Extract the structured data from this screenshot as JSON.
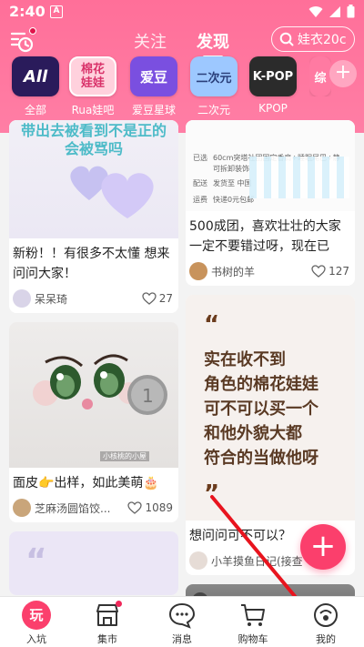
{
  "status_bar": {
    "time": "2:40",
    "notif_glyph": "A"
  },
  "nav": {
    "tabs": [
      {
        "label": "关注",
        "active": false
      },
      {
        "label": "发现",
        "active": true
      }
    ],
    "search_placeholder": "娃衣20c"
  },
  "channels": [
    {
      "icon_text": "All",
      "label": "全部",
      "color": "#2a1b5b",
      "selected": false
    },
    {
      "icon_text": "棉花\n娃娃",
      "label": "Rua娃吧",
      "color": "#ff8eb0",
      "selected": true
    },
    {
      "icon_text": "爱豆",
      "label": "爱豆星球",
      "color": "#7a4fe0",
      "selected": false
    },
    {
      "icon_text": "二次元",
      "label": "二次元",
      "color": "#9dc8ff",
      "selected": false
    },
    {
      "icon_text": "K-POP",
      "label": "KPOP",
      "color": "#2b2b2b",
      "selected": false
    },
    {
      "icon_text": "综",
      "label": "",
      "color": "#ff7aa2",
      "selected": false
    }
  ],
  "feed": {
    "left": [
      {
        "caption": "带出去被看到不是正的\n会被骂吗",
        "title": "新粉！！有很多不太懂 想来问问大家！",
        "author": "呆呆琦",
        "likes": "27"
      },
      {
        "title": "面皮👉出样，如此美萌🎂",
        "author": "芝麻汤圆馅饺...",
        "likes": "1089",
        "image_label": "小核桃的小屋"
      },
      {
        "quote_mark": "“"
      }
    ],
    "right": [
      {
        "list_rows": [
          "60cm突塔社团国定香肩+睡眠尾巴+静",
          "可拆卸装饰",
          "发货至 中国",
          "快递0元包邮"
        ],
        "list_keys": [
          "已选",
          "配送",
          "运费"
        ],
        "title": "500成团，喜欢壮壮的大家一定不要错过呀，现在已",
        "author": "书树的羊",
        "likes": "127"
      },
      {
        "quote_open": "“",
        "quote_lines": [
          "实在收不到",
          "角色的棉花娃娃",
          "可不可以买一个",
          "和他外貌大都",
          "符合的当做他呀"
        ],
        "quote_close": "”",
        "title": "想问问可不可以？",
        "author": "小羊摸鱼日记(接查"
      }
    ]
  },
  "fab": {
    "label": "+"
  },
  "bottom_nav": [
    {
      "label": "入坑",
      "icon_text": "玩",
      "active": true,
      "dot": false
    },
    {
      "label": "集市",
      "active": false,
      "dot": true
    },
    {
      "label": "消息",
      "active": false,
      "dot": false
    },
    {
      "label": "购物车",
      "active": false,
      "dot": false
    },
    {
      "label": "我的",
      "active": false,
      "dot": false
    }
  ],
  "colors": {
    "brand": "#ff6f99",
    "fab": "#fb3f6c",
    "annotation": "#e8141e"
  }
}
